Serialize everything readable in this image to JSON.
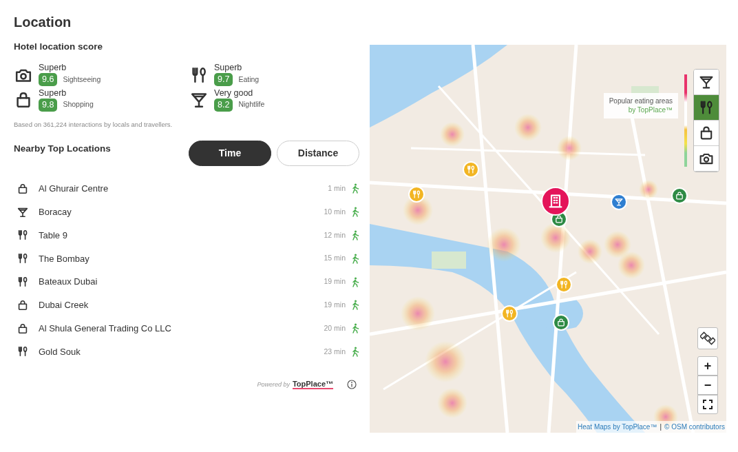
{
  "title": "Location",
  "score": {
    "heading": "Hotel location score",
    "items": [
      {
        "kind": "sightseeing",
        "rating": "Superb",
        "score": "9.6",
        "category": "Sightseeing"
      },
      {
        "kind": "eating",
        "rating": "Superb",
        "score": "9.7",
        "category": "Eating"
      },
      {
        "kind": "shopping",
        "rating": "Superb",
        "score": "9.8",
        "category": "Shopping"
      },
      {
        "kind": "nightlife",
        "rating": "Very good",
        "score": "8.2",
        "category": "Nightlife"
      }
    ],
    "note": "Based on 361,224 interactions by locals and travellers."
  },
  "nearby": {
    "heading": "Nearby Top Locations",
    "toggle": [
      {
        "label": "Time",
        "selected": true
      },
      {
        "label": "Distance",
        "selected": false
      }
    ],
    "items": [
      {
        "kind": "shopping",
        "name": "Al Ghurair Centre",
        "time": "1 min"
      },
      {
        "kind": "nightlife",
        "name": "Boracay",
        "time": "10 min"
      },
      {
        "kind": "eating",
        "name": "Table 9",
        "time": "12 min"
      },
      {
        "kind": "eating",
        "name": "The Bombay",
        "time": "15 min"
      },
      {
        "kind": "eating",
        "name": "Bateaux Dubai",
        "time": "19 min"
      },
      {
        "kind": "shopping",
        "name": "Dubai Creek",
        "time": "19 min"
      },
      {
        "kind": "shopping",
        "name": "Al Shula General Trading Co LLC",
        "time": "20 min"
      },
      {
        "kind": "eating",
        "name": "Gold Souk",
        "time": "23 min"
      }
    ]
  },
  "footer": {
    "powered": "Powered by",
    "brand": "TopPlace™"
  },
  "map": {
    "legend": {
      "title": "Popular eating areas",
      "byline": "by TopPlace™"
    },
    "layers": [
      {
        "kind": "nightlife",
        "selected": false
      },
      {
        "kind": "eating",
        "selected": true
      },
      {
        "kind": "shopping",
        "selected": false
      },
      {
        "kind": "sightseeing",
        "selected": false
      }
    ],
    "markers": [
      {
        "kind": "eating"
      },
      {
        "kind": "eating"
      },
      {
        "kind": "shopping"
      },
      {
        "kind": "hotel"
      },
      {
        "kind": "nightlife"
      },
      {
        "kind": "shopping"
      },
      {
        "kind": "eating"
      },
      {
        "kind": "eating"
      },
      {
        "kind": "shopping"
      }
    ],
    "zoom_in": "+",
    "zoom_out": "−",
    "attribution": [
      {
        "text": "Heat Maps by TopPlace™"
      },
      {
        "text": "© OSM contributors"
      }
    ],
    "separator": "|"
  }
}
